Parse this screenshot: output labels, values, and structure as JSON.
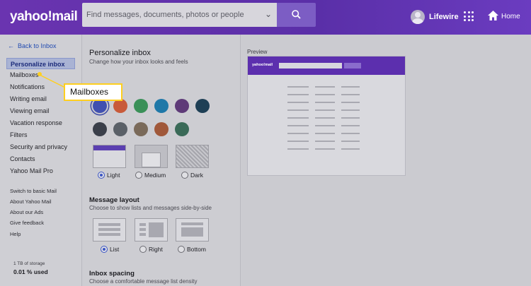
{
  "header": {
    "logo": "yahoo!mail",
    "search_placeholder": "Find messages, documents, photos or people",
    "user_name": "Lifewire",
    "home_label": "Home"
  },
  "sidebar": {
    "back_label": "Back to Inbox",
    "items": [
      {
        "label": "Personalize inbox",
        "active": true
      },
      {
        "label": "Mailboxes"
      },
      {
        "label": "Notifications"
      },
      {
        "label": "Writing email"
      },
      {
        "label": "Viewing email"
      },
      {
        "label": "Vacation response"
      },
      {
        "label": "Filters"
      },
      {
        "label": "Security and privacy"
      },
      {
        "label": "Contacts"
      },
      {
        "label": "Yahoo Mail Pro"
      }
    ],
    "links": [
      "Switch to basic Mail",
      "About Yahoo Mail",
      "About our Ads",
      "Give feedback",
      "Help"
    ],
    "storage_total": "1 TB of storage",
    "storage_used": "0.01 % used"
  },
  "main": {
    "title": "Personalize inbox",
    "subtitle": "Change how your inbox looks and feels",
    "theme_colors": [
      "#4050b0",
      "#c85a3a",
      "#3a9058",
      "#1f78a8",
      "#5e3a78",
      "#1e3f55",
      "#3a3f4a",
      "#5a6068",
      "#7a6a5a",
      "#a0583a",
      "#3a6a58"
    ],
    "brightness": {
      "options": [
        "Light",
        "Medium",
        "Dark"
      ],
      "selected": "Light"
    },
    "message_layout": {
      "title": "Message layout",
      "subtitle": "Choose to show lists and messages side-by-side",
      "options": [
        "List",
        "Right",
        "Bottom"
      ],
      "selected": "List"
    },
    "inbox_spacing": {
      "title": "Inbox spacing",
      "subtitle": "Choose a comfortable message list density"
    }
  },
  "preview": {
    "label": "Preview",
    "logo": "yahoo!mail"
  },
  "callout": {
    "label": "Mailboxes"
  },
  "colors": {
    "header": "#5a2fa8",
    "accent": "#3b55c4",
    "callout_border": "#ffcf1f"
  }
}
